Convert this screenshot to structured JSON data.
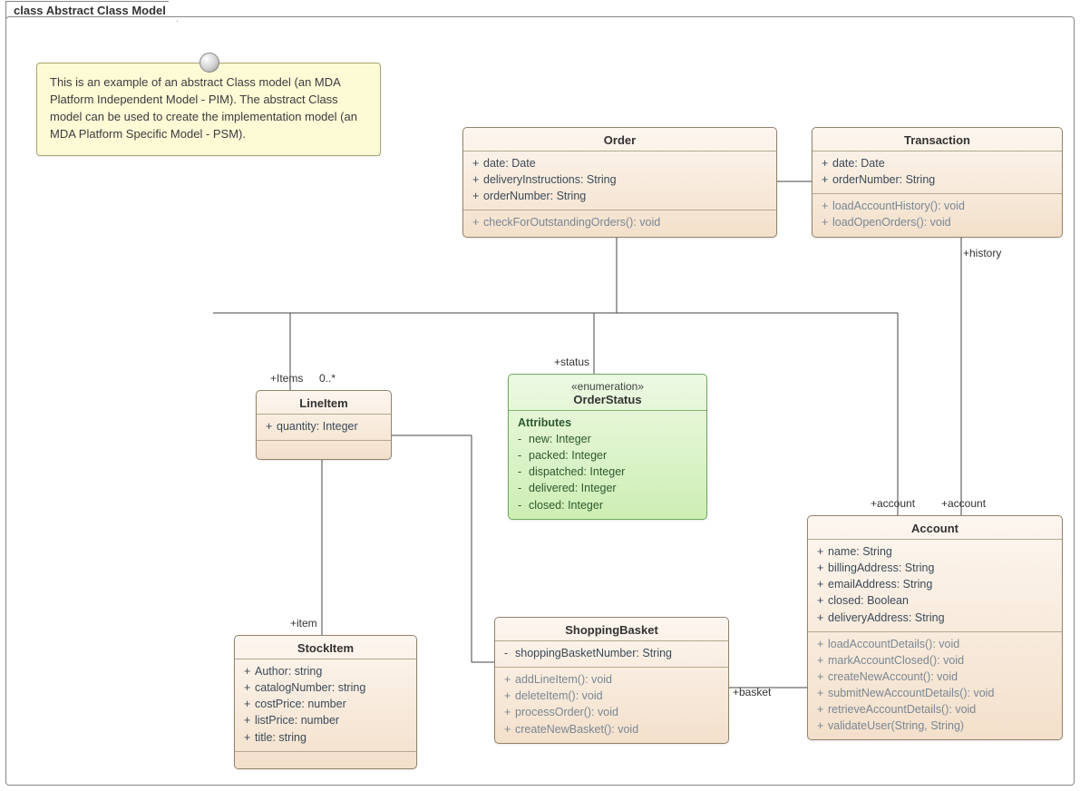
{
  "frame": {
    "title_prefix": "class",
    "title": "Abstract Class Model"
  },
  "note": {
    "text": "This is an example of an abstract Class model (an MDA Platform Independent Model - PIM). The abstract Class model can be used to create the implementation model (an MDA Platform Specific Model - PSM)."
  },
  "classes": {
    "order": {
      "name": "Order",
      "attrs": [
        {
          "vis": "+",
          "text": "date: Date"
        },
        {
          "vis": "+",
          "text": "deliveryInstructions: String"
        },
        {
          "vis": "+",
          "text": "orderNumber: String"
        }
      ],
      "methods": [
        {
          "vis": "+",
          "text": "checkForOutstandingOrders(): void"
        }
      ]
    },
    "transaction": {
      "name": "Transaction",
      "attrs": [
        {
          "vis": "+",
          "text": "date: Date"
        },
        {
          "vis": "+",
          "text": "orderNumber: String"
        }
      ],
      "methods": [
        {
          "vis": "+",
          "text": "loadAccountHistory(): void"
        },
        {
          "vis": "+",
          "text": "loadOpenOrders(): void"
        }
      ]
    },
    "lineitem": {
      "name": "LineItem",
      "attrs": [
        {
          "vis": "+",
          "text": "quantity: Integer"
        }
      ],
      "methods": []
    },
    "orderstatus": {
      "stereotype": "«enumeration»",
      "name": "OrderStatus",
      "section_header": "Attributes",
      "attrs": [
        {
          "vis": "-",
          "text": "new: Integer"
        },
        {
          "vis": "-",
          "text": "packed: Integer"
        },
        {
          "vis": "-",
          "text": "dispatched: Integer"
        },
        {
          "vis": "-",
          "text": "delivered: Integer"
        },
        {
          "vis": "-",
          "text": "closed: Integer"
        }
      ]
    },
    "stockitem": {
      "name": "StockItem",
      "attrs": [
        {
          "vis": "+",
          "text": "Author: string"
        },
        {
          "vis": "+",
          "text": "catalogNumber: string"
        },
        {
          "vis": "+",
          "text": "costPrice: number"
        },
        {
          "vis": "+",
          "text": "listPrice: number"
        },
        {
          "vis": "+",
          "text": "title: string"
        }
      ],
      "methods": []
    },
    "shoppingbasket": {
      "name": "ShoppingBasket",
      "attrs": [
        {
          "vis": "-",
          "text": "shoppingBasketNumber: String"
        }
      ],
      "methods": [
        {
          "vis": "+",
          "text": "addLineItem(): void"
        },
        {
          "vis": "+",
          "text": "deleteItem(): void"
        },
        {
          "vis": "+",
          "text": "processOrder(): void"
        },
        {
          "vis": "+",
          "text": "createNewBasket(): void"
        }
      ]
    },
    "account": {
      "name": "Account",
      "attrs": [
        {
          "vis": "+",
          "text": "name: String"
        },
        {
          "vis": "+",
          "text": "billingAddress: String"
        },
        {
          "vis": "+",
          "text": "emailAddress: String"
        },
        {
          "vis": "+",
          "text": "closed: Boolean"
        },
        {
          "vis": "+",
          "text": "deliveryAddress: String"
        }
      ],
      "methods": [
        {
          "vis": "+",
          "text": "loadAccountDetails(): void"
        },
        {
          "vis": "+",
          "text": "markAccountClosed(): void"
        },
        {
          "vis": "+",
          "text": "createNewAccount(): void"
        },
        {
          "vis": "+",
          "text": "submitNewAccountDetails(): void"
        },
        {
          "vis": "+",
          "text": "retrieveAccountDetails(): void"
        },
        {
          "vis": "+",
          "text": "validateUser(String, String)"
        }
      ]
    }
  },
  "labels": {
    "items": "+Items",
    "multi": "0..*",
    "status": "+status",
    "history": "+history",
    "item": "+item",
    "basket": "+basket",
    "account": "+account"
  }
}
